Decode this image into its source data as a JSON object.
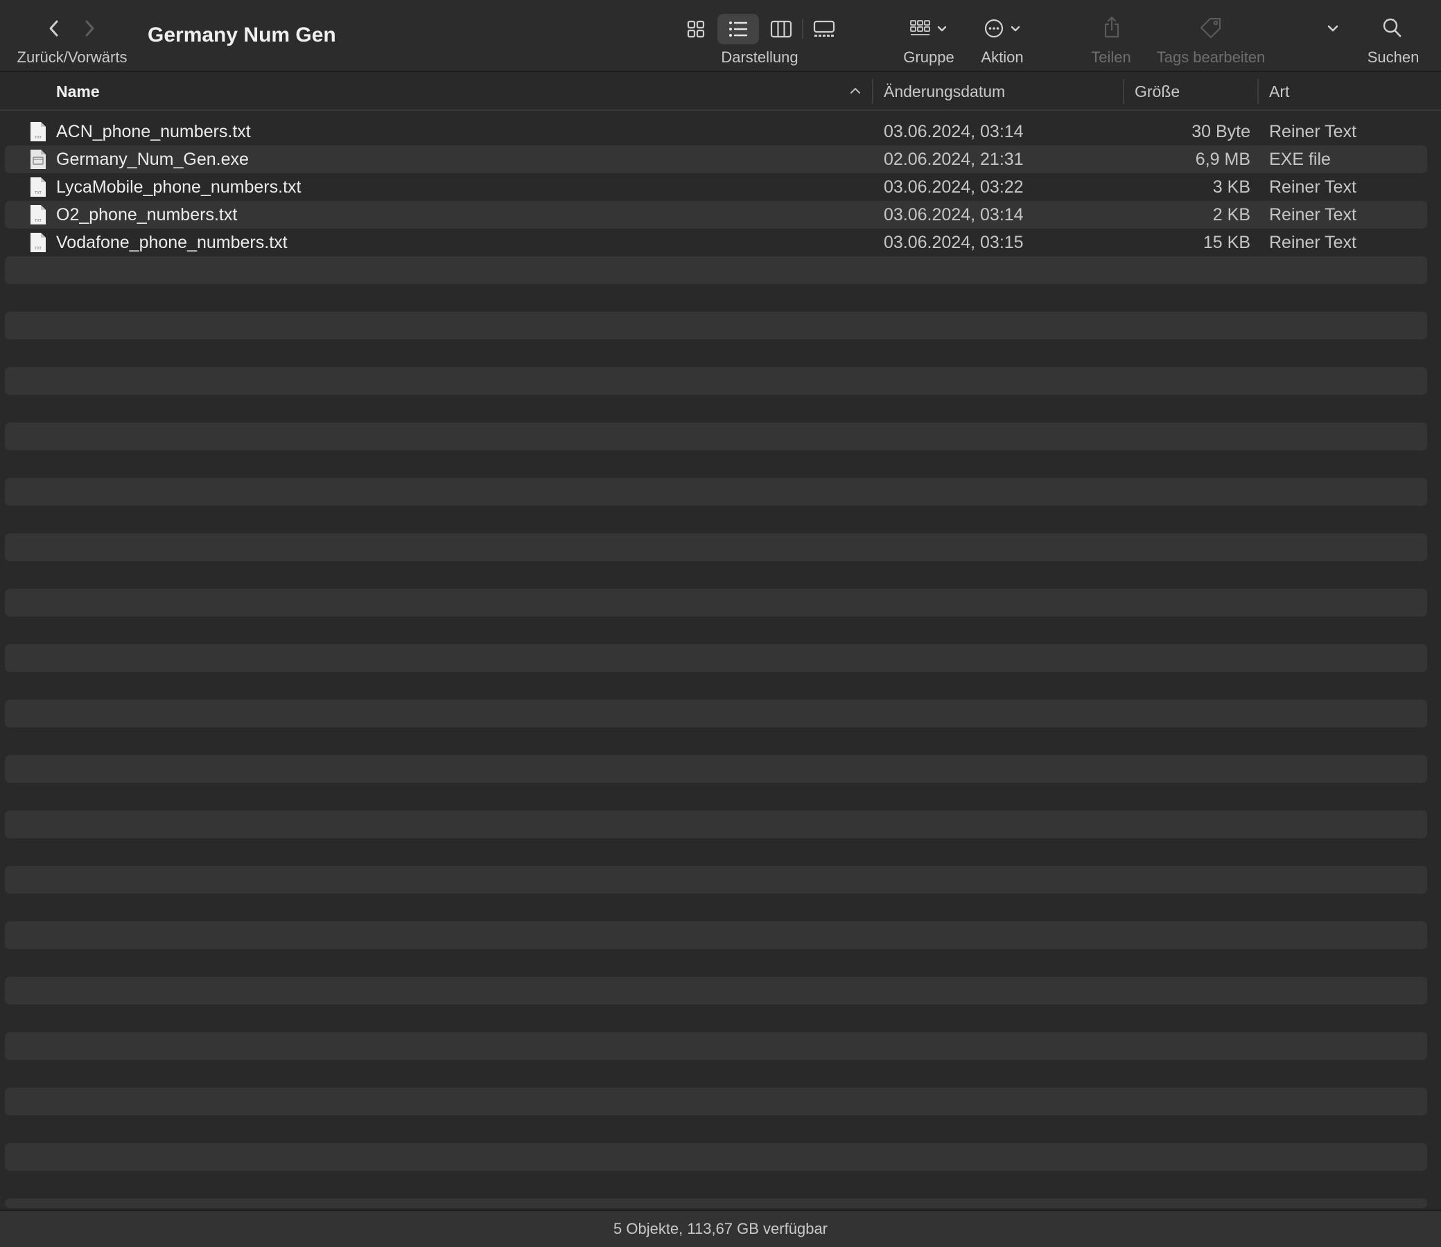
{
  "toolbar": {
    "nav_label": "Zurück/Vorwärts",
    "title": "Germany Num Gen",
    "view_label": "Darstellung",
    "group_label": "Gruppe",
    "action_label": "Aktion",
    "share_label": "Teilen",
    "tags_label": "Tags bearbeiten",
    "search_label": "Suchen"
  },
  "columns": {
    "name": "Name",
    "date": "Änderungsdatum",
    "size": "Größe",
    "kind": "Art"
  },
  "files": [
    {
      "name": "ACN_phone_numbers.txt",
      "date": "03.06.2024, 03:14",
      "size": "30 Byte",
      "kind": "Reiner Text",
      "icon": "txt-file-icon"
    },
    {
      "name": "Germany_Num_Gen.exe",
      "date": "02.06.2024, 21:31",
      "size": "6,9 MB",
      "kind": "EXE file",
      "icon": "exe-file-icon"
    },
    {
      "name": "LycaMobile_phone_numbers.txt",
      "date": "03.06.2024, 03:22",
      "size": "3 KB",
      "kind": "Reiner Text",
      "icon": "txt-file-icon"
    },
    {
      "name": "O2_phone_numbers.txt",
      "date": "03.06.2024, 03:14",
      "size": "2 KB",
      "kind": "Reiner Text",
      "icon": "txt-file-icon"
    },
    {
      "name": "Vodafone_phone_numbers.txt",
      "date": "03.06.2024, 03:15",
      "size": "15 KB",
      "kind": "Reiner Text",
      "icon": "txt-file-icon"
    }
  ],
  "status": {
    "text": "5 Objekte, 113,67 GB verfügbar"
  },
  "colors": {
    "background": "#292929",
    "stripe": "#353535",
    "toolbar": "#2c2c2c",
    "text": "#ececec"
  }
}
